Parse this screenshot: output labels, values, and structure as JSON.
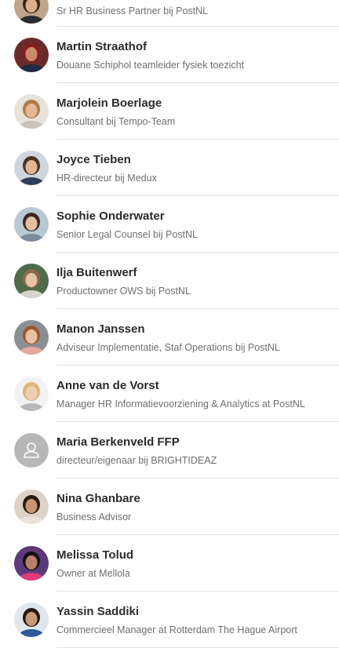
{
  "people": [
    {
      "name": "",
      "title": "Sr HR Business Partner bij PostNL",
      "avatar": {
        "type": "photo",
        "skin": "#d9b08c",
        "hair": "#3a2418",
        "bg": "#bfa58a",
        "shirt": "#2c2c2c"
      }
    },
    {
      "name": "Martin Straathof",
      "title": "Douane Schiphol teamleider fysiek toezicht",
      "avatar": {
        "type": "photo",
        "skin": "#c98b6b",
        "hair": "#8a1f1f",
        "bg": "#6b2a2a",
        "shirt": "#1f2a44"
      }
    },
    {
      "name": "Marjolein Boerlage",
      "title": "Consultant bij Tempo-Team",
      "avatar": {
        "type": "photo",
        "skin": "#e3b896",
        "hair": "#b07c4a",
        "bg": "#e7e2da",
        "shirt": "#c9c3bb"
      }
    },
    {
      "name": "Joyce Tieben",
      "title": "HR-directeur bij Medux",
      "avatar": {
        "type": "photo",
        "skin": "#e0b494",
        "hair": "#4a3324",
        "bg": "#cfd6dd",
        "shirt": "#2f3e58"
      }
    },
    {
      "name": "Sophie Onderwater",
      "title": "Senior Legal Counsel bij PostNL",
      "avatar": {
        "type": "photo",
        "skin": "#e4bfa2",
        "hair": "#3b2a22",
        "bg": "#b9c9d4",
        "shirt": "#7a8b9c"
      }
    },
    {
      "name": "Ilja Buitenwerf",
      "title": "Productowner OWS bij PostNL",
      "avatar": {
        "type": "photo",
        "skin": "#e6c2a6",
        "hair": "#8a6a4a",
        "bg": "#4e6b4a",
        "shirt": "#d8d2c8"
      }
    },
    {
      "name": "Manon Janssen",
      "title": "Adviseur Implementatie, Staf Operations bij PostNL",
      "avatar": {
        "type": "photo",
        "skin": "#e8bfa0",
        "hair": "#9a5a32",
        "bg": "#8a8f94",
        "shirt": "#e6a6a0"
      }
    },
    {
      "name": "Anne van de Vorst",
      "title": "Manager HR Informatievoorziening & Analytics at PostNL",
      "avatar": {
        "type": "photo",
        "skin": "#efcfb5",
        "hair": "#d9b77a",
        "bg": "#f2f2f2",
        "shirt": "#b9b9b9"
      }
    },
    {
      "name": "Maria Berkenveld FFP",
      "title": "directeur/eigenaar bij BRIGHTIDEAZ",
      "avatar": {
        "type": "placeholder",
        "bg": "#b7b7b7",
        "fg": "#ffffff"
      }
    },
    {
      "name": "Nina Ghanbare",
      "title": "Business Advisor",
      "avatar": {
        "type": "photo",
        "skin": "#c99473",
        "hair": "#2a1a12",
        "bg": "#dcd2c6",
        "shirt": "#e9e3dc"
      }
    },
    {
      "name": "Melissa Tolud",
      "title": "Owner at Mellola",
      "avatar": {
        "type": "photo",
        "skin": "#b88066",
        "hair": "#151018",
        "bg": "#5a3a7a",
        "shirt": "#e23a7a"
      }
    },
    {
      "name": "Yassin Saddiki",
      "title": "Commercieel Manager at Rotterdam The Hague Airport",
      "avatar": {
        "type": "photo",
        "skin": "#c99a7a",
        "hair": "#241812",
        "bg": "#dfe6ec",
        "shirt": "#2b5a9a"
      }
    }
  ]
}
